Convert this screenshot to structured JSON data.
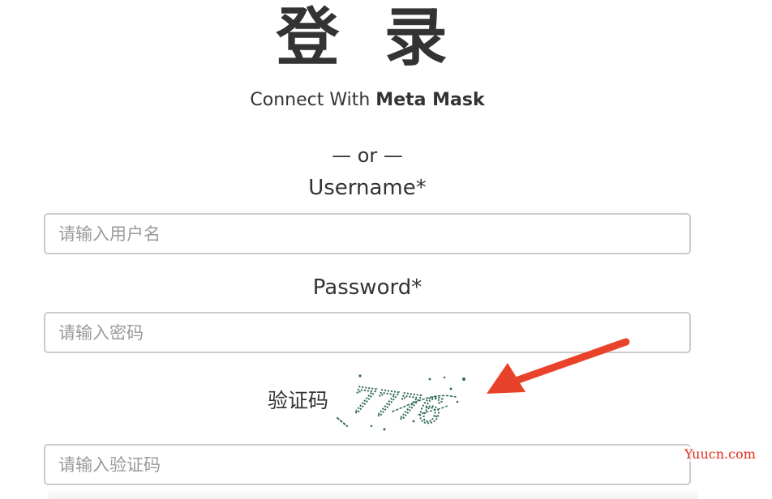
{
  "title": "登 录",
  "connect": {
    "prefix": "Connect With",
    "brand": "Meta Mask"
  },
  "divider": "— or —",
  "username": {
    "label": "Username*",
    "placeholder": "请输入用户名",
    "value": ""
  },
  "password": {
    "label": "Password*",
    "placeholder": "请输入密码",
    "value": ""
  },
  "captcha": {
    "label": "验证码",
    "code": "7776",
    "placeholder": "请输入验证码",
    "value": "",
    "text_color": "#2f6b4f"
  },
  "annotation": {
    "arrow_color": "#e8432a"
  },
  "watermark": "Yuucn.com"
}
